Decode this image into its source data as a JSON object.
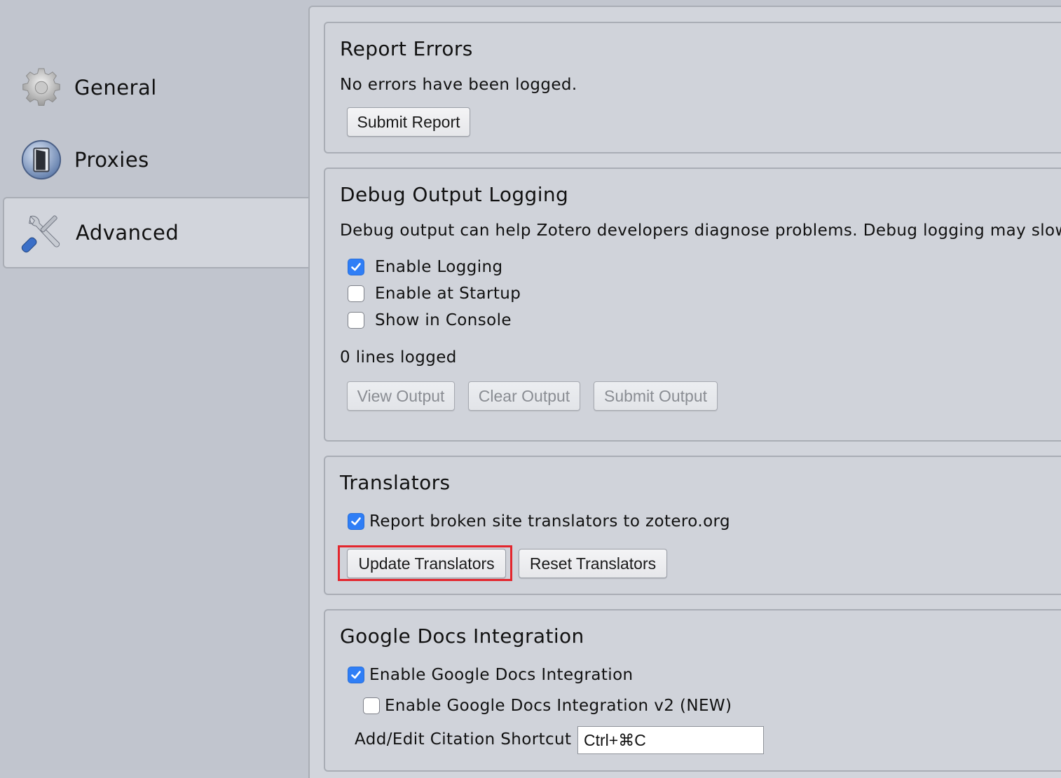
{
  "sidebar": {
    "items": [
      {
        "label": "General",
        "icon": "gear-icon"
      },
      {
        "label": "Proxies",
        "icon": "proxy-door-icon"
      },
      {
        "label": "Advanced",
        "icon": "wrench-screwdriver-icon",
        "selected": true
      }
    ]
  },
  "report_errors": {
    "title": "Report Errors",
    "status": "No errors have been logged.",
    "submit_label": "Submit Report"
  },
  "debug": {
    "title": "Debug Output Logging",
    "description": "Debug output can help Zotero developers diagnose problems. Debug logging may slow d",
    "enable_logging": {
      "label": "Enable Logging",
      "checked": true
    },
    "enable_startup": {
      "label": "Enable at Startup",
      "checked": false
    },
    "show_console": {
      "label": "Show in Console",
      "checked": false
    },
    "lines_logged": "0 lines logged",
    "view_label": "View Output",
    "clear_label": "Clear Output",
    "submit_label": "Submit Output"
  },
  "translators": {
    "title": "Translators",
    "report_broken": {
      "label": "Report broken site translators to zotero.org",
      "checked": true
    },
    "update_label": "Update Translators",
    "reset_label": "Reset Translators"
  },
  "gdocs": {
    "title": "Google Docs Integration",
    "enable": {
      "label": "Enable Google Docs Integration",
      "checked": true
    },
    "enable_v2": {
      "label": "Enable Google Docs Integration v2 (NEW)",
      "checked": false
    },
    "shortcut_label": "Add/Edit Citation Shortcut",
    "shortcut_value": "Ctrl+⌘C"
  },
  "colors": {
    "accent": "#2f7ef6",
    "highlight": "#e3262d"
  }
}
